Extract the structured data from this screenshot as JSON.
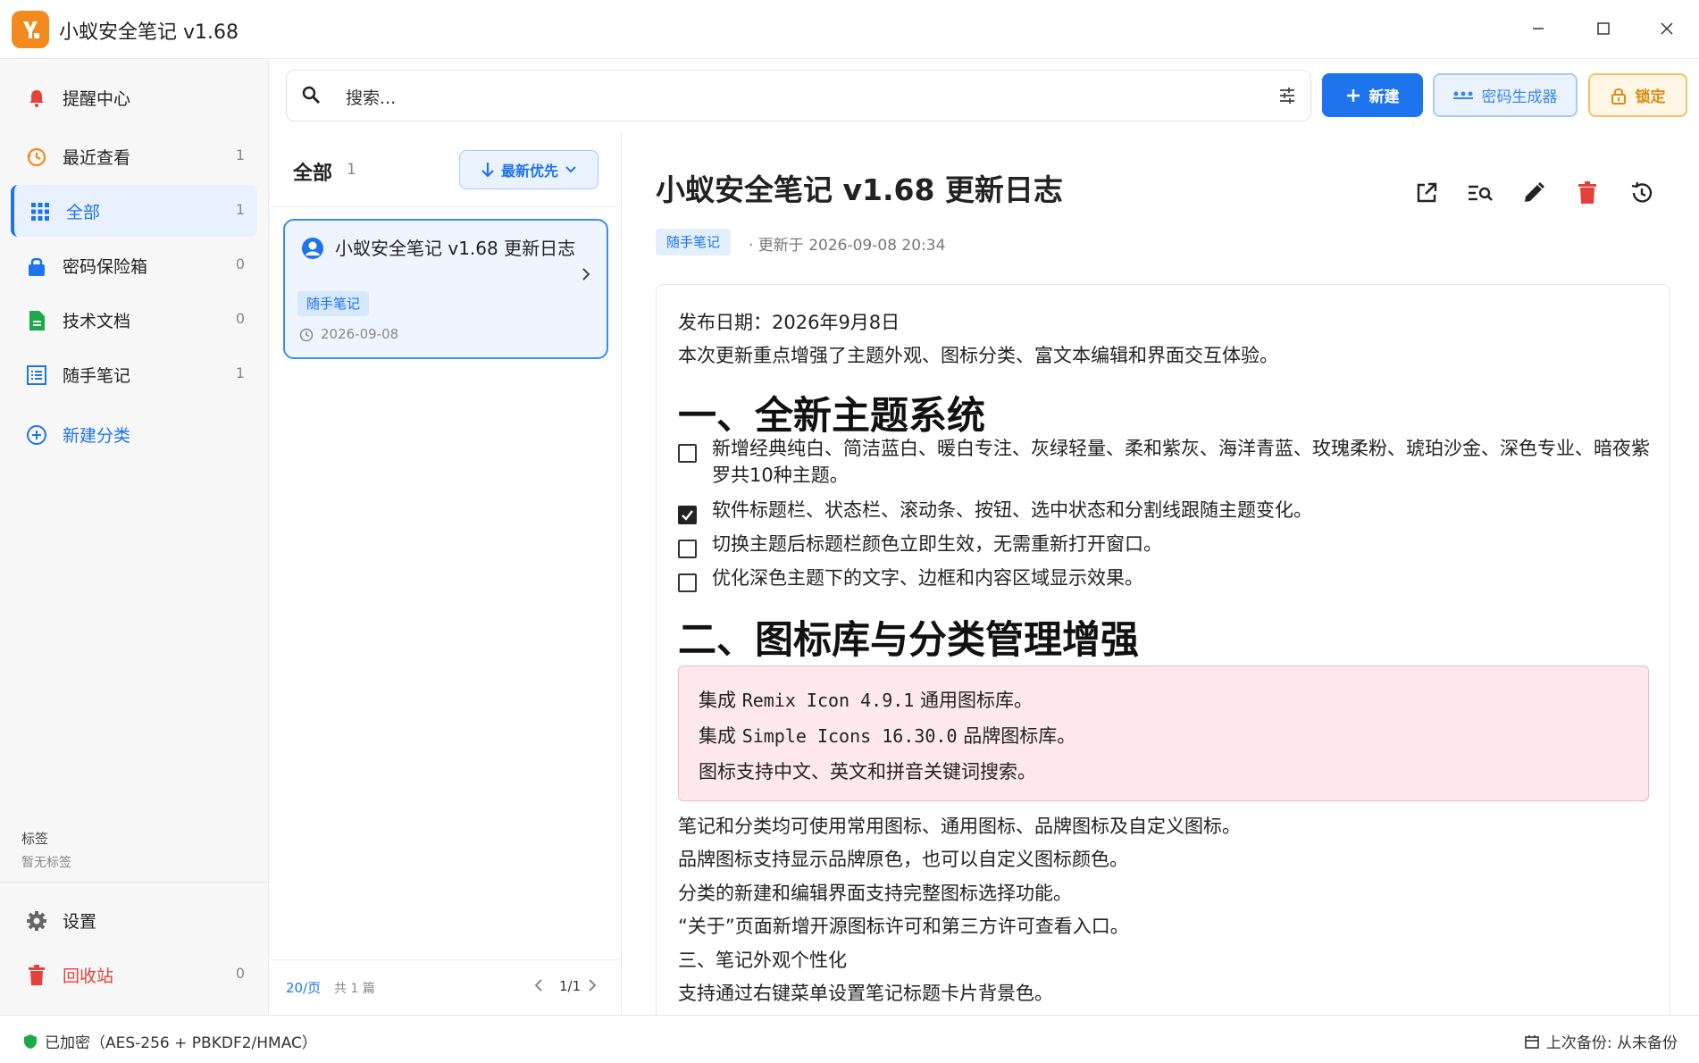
{
  "app": {
    "title": "小蚁安全笔记 v1.68"
  },
  "sidebar": {
    "items": [
      {
        "label": "提醒中心",
        "count": ""
      },
      {
        "label": "最近查看",
        "count": "1"
      },
      {
        "label": "全部",
        "count": "1"
      },
      {
        "label": "密码保险箱",
        "count": "0"
      },
      {
        "label": "技术文档",
        "count": "0"
      },
      {
        "label": "随手笔记",
        "count": "1"
      },
      {
        "label": "新建分类",
        "count": ""
      }
    ],
    "tags_title": "标签",
    "tags_empty": "暂无标签",
    "settings": "设置",
    "trash": {
      "label": "回收站",
      "count": "0"
    }
  },
  "search": {
    "value": "搜索..."
  },
  "toolbar": {
    "new_label": "新建",
    "generator_label": "密码生成器",
    "lock_label": "锁定"
  },
  "list": {
    "title": "全部",
    "count": "1",
    "sort_label": "最新优先",
    "note": {
      "title": "小蚁安全笔记 v1.68 更新日志",
      "tag": "随手笔记",
      "date": "2026-09-08"
    },
    "pager": {
      "size": "20/页",
      "total": "共 1 篇",
      "page": "1/1"
    }
  },
  "detail": {
    "title": "小蚁安全笔记 v1.68 更新日志",
    "tag": "随手笔记",
    "updated": "· 更新于 2026-09-08 20:34",
    "release_date": "发布日期：2026年9月8日",
    "intro": "本次更新重点增强了主题外观、图标分类、富文本编辑和界面交互体验。",
    "h1_a": "一、全新主题系统",
    "checklist": [
      {
        "checked": false,
        "text": "新增经典纯白、简洁蓝白、暖白专注、灰绿轻量、柔和紫灰、海洋青蓝、玫瑰柔粉、琥珀沙金、深色专业、暗夜紫罗共10种主题。"
      },
      {
        "checked": true,
        "text": "软件标题栏、状态栏、滚动条、按钮、选中状态和分割线跟随主题变化。"
      },
      {
        "checked": false,
        "text": "切换主题后标题栏颜色立即生效，无需重新打开窗口。"
      },
      {
        "checked": false,
        "text": "优化深色主题下的文字、边框和内容区域显示效果。"
      }
    ],
    "h1_b": "二、图标库与分类管理增强",
    "pink": {
      "l1_a": "集成 ",
      "l1_code": "Remix Icon 4.9.1",
      "l1_b": " 通用图标库。",
      "l2_a": "集成 ",
      "l2_code": "Simple Icons 16.30.0",
      "l2_b": " 品牌图标库。",
      "l3": "图标支持中文、英文和拼音关键词搜索。"
    },
    "paras": [
      "笔记和分类均可使用常用图标、通用图标、品牌图标及自定义图标。",
      "品牌图标支持显示品牌原色，也可以自定义图标颜色。",
      "分类的新建和编辑界面支持完整图标选择功能。",
      "“关于”页面新增开源图标许可和第三方许可查看入口。",
      "三、笔记外观个性化",
      "支持通过右键菜单设置笔记标题卡片背景色。"
    ]
  },
  "status": {
    "left": "已加密（AES-256 + PBKDF2/HMAC）",
    "right": "上次备份: 从未备份"
  },
  "colors": {
    "accent": "#1e74ec",
    "danger": "#e5413a",
    "warning": "#e08a12",
    "logo": "#f28a1e",
    "success": "#1fa84a"
  }
}
